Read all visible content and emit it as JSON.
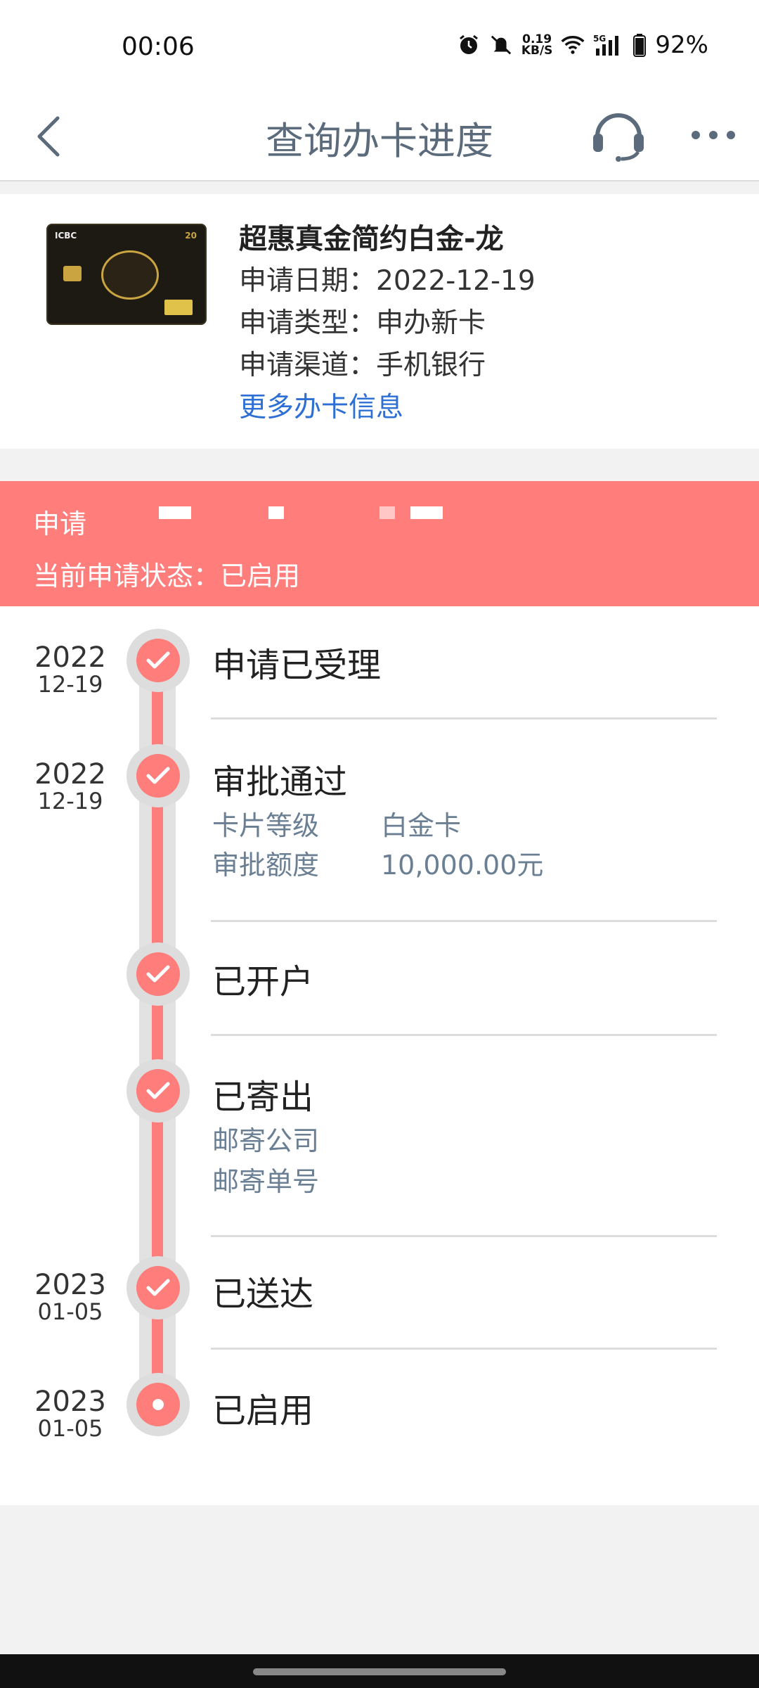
{
  "status_bar": {
    "time": "00:06",
    "net_speed_value": "0.19",
    "net_speed_unit": "KB/S",
    "network_type": "5G",
    "battery": "92%"
  },
  "nav": {
    "title": "查询办卡进度"
  },
  "card": {
    "name": "超惠真金简约白金-龙",
    "apply_date": "申请日期：2022-12-19",
    "apply_type": "申请类型：申办新卡",
    "apply_channel": "申请渠道：手机银行",
    "more_link": "更多办卡信息",
    "image_brand": "ICBC",
    "image_number": "20"
  },
  "banner": {
    "line1": "申请",
    "line2": "当前申请状态：已启用",
    "color": "#ff7d7b"
  },
  "timeline": {
    "accent_color": "#ff7d7b",
    "steps": [
      {
        "year": "2022",
        "md": "12-19",
        "title": "申请已受理"
      },
      {
        "year": "2022",
        "md": "12-19",
        "title": "审批通过",
        "details": [
          {
            "key": "卡片等级",
            "value": "白金卡"
          },
          {
            "key": "审批额度",
            "value": "10,000.00元"
          }
        ]
      },
      {
        "title": "已开户"
      },
      {
        "title": "已寄出",
        "details": [
          {
            "key": "邮寄公司"
          },
          {
            "key": "邮寄单号"
          }
        ]
      },
      {
        "year": "2023",
        "md": "01-05",
        "title": "已送达"
      },
      {
        "year": "2023",
        "md": "01-05",
        "title": "已启用"
      }
    ]
  }
}
